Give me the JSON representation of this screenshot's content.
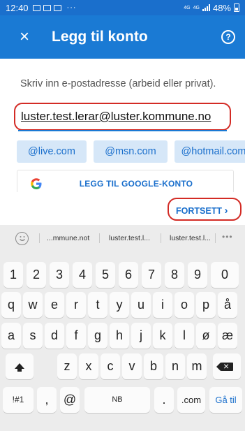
{
  "status_bar": {
    "time": "12:40",
    "dots": "···",
    "net_top": "4G",
    "net_bottom": "4G",
    "battery": "48%"
  },
  "app_bar": {
    "close_icon": "×",
    "title": "Legg til konto",
    "help_icon": "?"
  },
  "form": {
    "instruction": "Skriv inn e-postadresse (arbeid eller privat).",
    "email_value": "luster.test.lerar@luster.kommune.no",
    "domain_chips": [
      "@live.com",
      "@msn.com",
      "@hotmail.com"
    ],
    "google_button": "LEGG TIL GOOGLE-KONTO",
    "continue_button": "FORTSETT",
    "continue_chevron": "›"
  },
  "keyboard": {
    "suggestions": [
      "...mmune.not",
      "luster.test.l...",
      "luster.test.l..."
    ],
    "more_suggestions": "•••",
    "row_numbers": [
      "1",
      "2",
      "3",
      "4",
      "5",
      "6",
      "7",
      "8",
      "9",
      "0"
    ],
    "row1": [
      "q",
      "w",
      "e",
      "r",
      "t",
      "y",
      "u",
      "i",
      "o",
      "p",
      "å"
    ],
    "row2": [
      "a",
      "s",
      "d",
      "f",
      "g",
      "h",
      "j",
      "k",
      "l",
      "ø",
      "æ"
    ],
    "row3": [
      "z",
      "x",
      "c",
      "v",
      "b",
      "n",
      "m"
    ],
    "row4": {
      "symbols": "!#1",
      "comma": ",",
      "at": "@",
      "space": "NB",
      "period": ".",
      "dot_com": ".com",
      "go": "Gå til"
    }
  },
  "colors": {
    "header_blue": "#1a7ad4",
    "status_blue": "#1a6fcc",
    "highlight_red": "#d32b25",
    "chip_bg": "#d6e7f8"
  }
}
